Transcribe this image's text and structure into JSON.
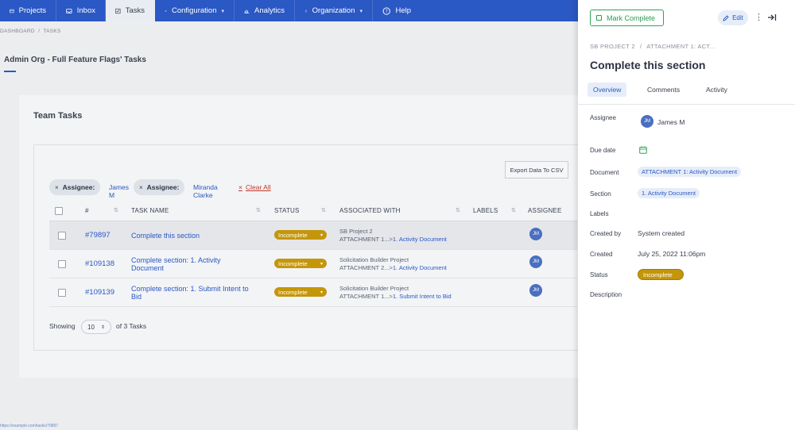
{
  "nav": {
    "items": [
      {
        "label": "Projects",
        "icon": "projects-icon"
      },
      {
        "label": "Inbox",
        "icon": "inbox-icon"
      },
      {
        "label": "Tasks",
        "icon": "tasks-icon",
        "active": true
      },
      {
        "label": "Configuration",
        "icon": "gear-icon",
        "dropdown": true
      },
      {
        "label": "Analytics",
        "icon": "analytics-icon"
      },
      {
        "label": "Organization",
        "icon": "organization-icon",
        "dropdown": true
      },
      {
        "label": "Help",
        "icon": "help-icon"
      }
    ]
  },
  "breadcrumb": {
    "dashboard": "DASHBOARD",
    "sep": "/",
    "tasks": "TASKS"
  },
  "page_title": "Admin Org - Full Feature Flags' Tasks",
  "team_tasks": {
    "title": "Team Tasks",
    "export_label": "Export Data To CSV",
    "filters": [
      {
        "key": "Assignee:",
        "value": "James M"
      },
      {
        "key": "Assignee:",
        "value": "Miranda Clarke"
      }
    ],
    "clear_all": "Clear All",
    "columns": {
      "num": "#",
      "task_name": "TASK NAME",
      "status": "STATUS",
      "associated_with": "ASSOCIATED WITH",
      "labels": "LABELS",
      "assignee": "ASSIGNEE"
    },
    "rows": [
      {
        "num": "#79897",
        "name": "Complete this section",
        "status": "Incomplete",
        "assoc_line1": "SB Project 2",
        "assoc_line2": "ATTACHMENT 1...>",
        "assoc_link": "1. Activity Document",
        "assignee": "JM"
      },
      {
        "num": "#109138",
        "name": "Complete section: 1. Activity Document",
        "status": "Incomplete",
        "assoc_line1": "Solicitation Builder Project",
        "assoc_line2": "ATTACHMENT 2...>",
        "assoc_link": "1. Activity Document",
        "assignee": "JM"
      },
      {
        "num": "#109139",
        "name": "Complete section: 1. Submit Intent to Bid",
        "status": "Incomplete",
        "assoc_line1": "Solicitation Builder Project",
        "assoc_line2": "ATTACHMENT 1...>",
        "assoc_link": "1. Submit Intent to Bid",
        "assignee": "JM"
      }
    ],
    "showing_label": "Showing",
    "page_size": "10",
    "count_label": "of 3 Tasks"
  },
  "status_url": "https://example.com/tasks/79897",
  "panel": {
    "mark_complete": "Mark Complete",
    "edit": "Edit",
    "breadcrumb": {
      "project": "SB PROJECT 2",
      "sep": "/",
      "attachment": "ATTACHMENT 1: ACT..."
    },
    "title": "Complete this section",
    "tabs": [
      "Overview",
      "Comments",
      "Activity"
    ],
    "active_tab": "Overview",
    "fields": {
      "assignee_label": "Assignee",
      "assignee_initials": "JM",
      "assignee_name": "James M",
      "due_label": "Due date",
      "document_label": "Document",
      "document_value": "ATTACHMENT 1: Activity Document",
      "section_label": "Section",
      "section_value": "1. Activity Document",
      "labels_label": "Labels",
      "created_by_label": "Created by",
      "created_by_value": "System created",
      "created_label": "Created",
      "created_value": "July 25, 2022 11:06pm",
      "status_label": "Status",
      "status_value": "Incomplete",
      "description_label": "Description"
    }
  },
  "colors": {
    "brand": "#2a58c4",
    "status_incomplete": "#c4960a",
    "complete_green": "#2fa35a"
  }
}
